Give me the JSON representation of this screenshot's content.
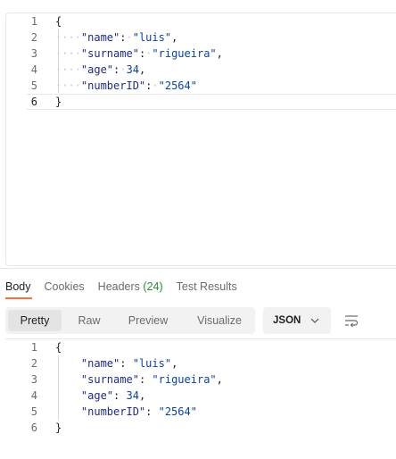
{
  "request_body": {
    "lines": [
      {
        "num": "1",
        "text": "{"
      },
      {
        "num": "2",
        "key": "\"name\"",
        "value": "\"luis\"",
        "trail": ","
      },
      {
        "num": "3",
        "key": "\"surname\"",
        "value": "\"rigueira\"",
        "trail": ","
      },
      {
        "num": "4",
        "key": "\"age\"",
        "value": "34",
        "trail": ","
      },
      {
        "num": "5",
        "key": "\"numberID\"",
        "value": "\"2564\"",
        "trail": ""
      },
      {
        "num": "6",
        "text": "}"
      }
    ]
  },
  "response_tabs": [
    {
      "label": "Body"
    },
    {
      "label": "Cookies"
    },
    {
      "label": "Headers",
      "count": "(24)"
    },
    {
      "label": "Test Results"
    }
  ],
  "format_options": [
    "Pretty",
    "Raw",
    "Preview",
    "Visualize"
  ],
  "language": "JSON",
  "response_body": {
    "lines": [
      {
        "num": "1",
        "text": "{"
      },
      {
        "num": "2",
        "key": "\"name\"",
        "value": "\"luis\"",
        "trail": ","
      },
      {
        "num": "3",
        "key": "\"surname\"",
        "value": "\"rigueira\"",
        "trail": ","
      },
      {
        "num": "4",
        "key": "\"age\"",
        "value": "34",
        "trail": ","
      },
      {
        "num": "5",
        "key": "\"numberID\"",
        "value": "\"2564\"",
        "trail": ""
      },
      {
        "num": "6",
        "text": "}"
      }
    ]
  },
  "colors": {
    "accent": "#ff6c37",
    "count_green": "#2c8a3f",
    "key": "#1f2b84",
    "string": "#0b41a8"
  },
  "icons": {
    "dropdown": "chevron-down-icon",
    "wrap": "wrap-lines-icon"
  }
}
